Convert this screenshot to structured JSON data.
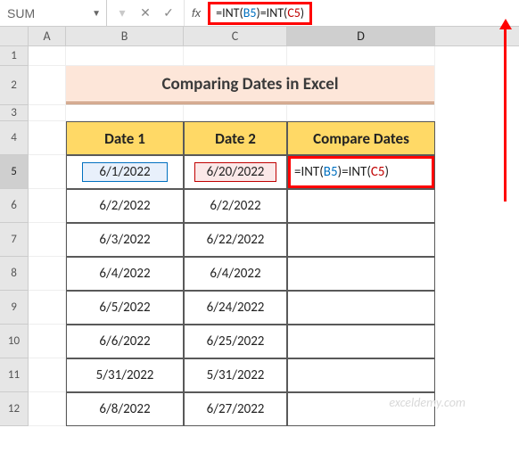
{
  "nameBox": {
    "value": "SUM"
  },
  "formulaBar": {
    "prefix": "=INT(",
    "ref1": "B5",
    "mid": ")=INT(",
    "ref2": "C5",
    "suffix": ")"
  },
  "columns": [
    "A",
    "B",
    "C",
    "D"
  ],
  "rowNumbers": [
    "1",
    "2",
    "3",
    "4",
    "5",
    "6",
    "7",
    "8",
    "9",
    "10",
    "11",
    "12"
  ],
  "title": "Comparing Dates in Excel",
  "headers": {
    "b": "Date 1",
    "c": "Date 2",
    "d": "Compare Dates"
  },
  "cellD5": {
    "prefix": "=INT(",
    "ref1": "B5",
    "mid": ")=INT(",
    "ref2": "C5",
    "suffix": ")"
  },
  "table": [
    {
      "b": "6/1/2022",
      "c": "6/20/2022"
    },
    {
      "b": "6/2/2022",
      "c": "6/2/2022"
    },
    {
      "b": "6/3/2022",
      "c": "6/22/2022"
    },
    {
      "b": "6/4/2022",
      "c": "6/4/2022"
    },
    {
      "b": "6/5/2022",
      "c": "6/24/2022"
    },
    {
      "b": "6/6/2022",
      "c": "6/25/2022"
    },
    {
      "b": "5/31/2022",
      "c": "5/31/2022"
    },
    {
      "b": "6/8/2022",
      "c": "6/27/2022"
    }
  ],
  "watermark": "exceldemy.com"
}
